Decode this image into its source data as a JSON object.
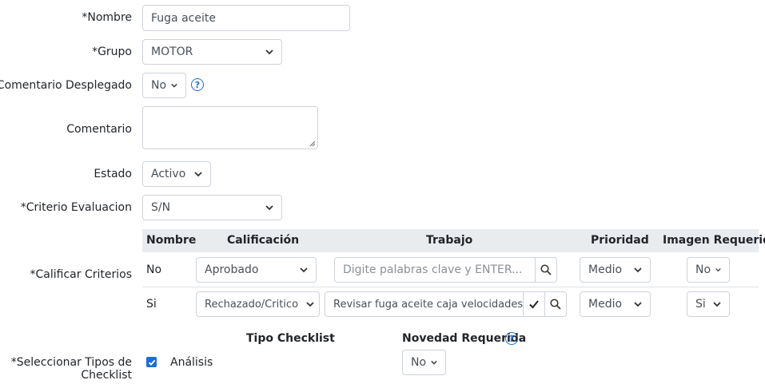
{
  "form": {
    "nombre": {
      "label": "*Nombre",
      "value": "Fuga aceite"
    },
    "grupo": {
      "label": "*Grupo",
      "value": "MOTOR"
    },
    "comentario_desplegado": {
      "label": "Comentario Desplegado",
      "value": "No",
      "help": "?"
    },
    "comentario": {
      "label": "Comentario",
      "value": ""
    },
    "estado": {
      "label": "Estado",
      "value": "Activo"
    },
    "criterio_evaluacion": {
      "label": "*Criterio Evaluacion",
      "value": "S/N"
    },
    "calificar_criterios": {
      "label": "*Calificar Criterios"
    },
    "tipos_checklist": {
      "label_line1": "*Seleccionar Tipos de",
      "label_line2": "Checklist"
    }
  },
  "criteria_table": {
    "headers": [
      "Nombre",
      "Calificación",
      "Trabajo",
      "Prioridad",
      "Imagen Requerida"
    ],
    "rows": [
      {
        "nombre": "No",
        "calificacion": "Aprobado",
        "trabajo_placeholder": "Digite palabras clave y ENTER...",
        "trabajo": "",
        "prioridad": "Medio",
        "imagen": "No"
      },
      {
        "nombre": "Si",
        "calificacion": "Rechazado/Critico",
        "trabajo_placeholder": "",
        "trabajo": "Revisar fuga aceite caja velocidades",
        "prioridad": "Medio",
        "imagen": "Si"
      }
    ]
  },
  "checklist": {
    "tipo_header": "Tipo Checklist",
    "novedad_header": "Novedad Requerida",
    "novedad_help": "?",
    "items": [
      {
        "name": "Análisis",
        "checked": true,
        "novedad": "No"
      }
    ]
  },
  "colors": {
    "accent": "#1a6fd8",
    "border": "#ced4da",
    "header_bg": "#e9ecef"
  }
}
